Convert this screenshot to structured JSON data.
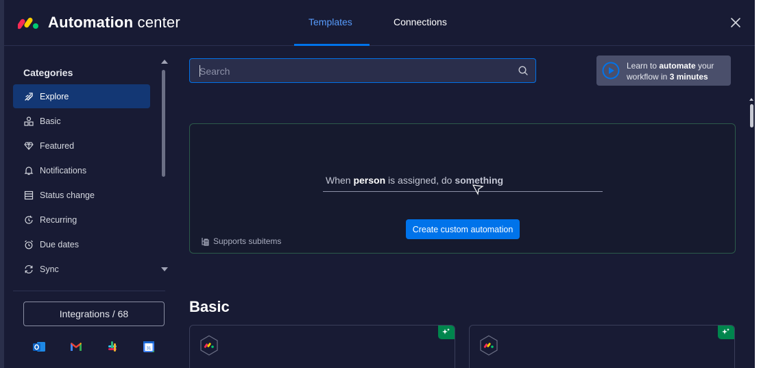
{
  "header": {
    "title_bold": "Automation",
    "title_light": " center",
    "tabs": [
      {
        "label": "Templates",
        "active": true
      },
      {
        "label": "Connections",
        "active": false
      }
    ],
    "close_icon": "close-icon"
  },
  "sidebar": {
    "title": "Categories",
    "items": [
      {
        "label": "Explore",
        "icon": "rocket-icon",
        "active": true
      },
      {
        "label": "Basic",
        "icon": "shapes-icon",
        "active": false
      },
      {
        "label": "Featured",
        "icon": "diamond-icon",
        "active": false
      },
      {
        "label": "Notifications",
        "icon": "bell-icon",
        "active": false
      },
      {
        "label": "Status change",
        "icon": "list-icon",
        "active": false
      },
      {
        "label": "Recurring",
        "icon": "recurring-icon",
        "active": false
      },
      {
        "label": "Due dates",
        "icon": "alarm-clock-icon",
        "active": false
      },
      {
        "label": "Sync",
        "icon": "sync-icon",
        "active": false
      }
    ],
    "integrations_label": "Integrations / 68",
    "apps": [
      "outlook-icon",
      "gmail-icon",
      "slack-icon",
      "google-calendar-icon"
    ]
  },
  "search": {
    "placeholder": "Search",
    "value": ""
  },
  "learn": {
    "prefix": "Learn to ",
    "bold1": "automate",
    "mid": " your",
    "line2_prefix": "workflow in ",
    "bold2": "3 minutes"
  },
  "custom": {
    "sentence_1": "When ",
    "sentence_bold_1": "person",
    "sentence_2": " is assigned, do ",
    "sentence_bold_2": "something",
    "create_label": "Create custom automation",
    "supports_label": "Supports subitems"
  },
  "section": {
    "title": "Basic"
  },
  "colors": {
    "accent": "#0073ea",
    "active_item_bg": "#133774",
    "modal_bg": "#181b34",
    "badge_green": "#00854d"
  }
}
